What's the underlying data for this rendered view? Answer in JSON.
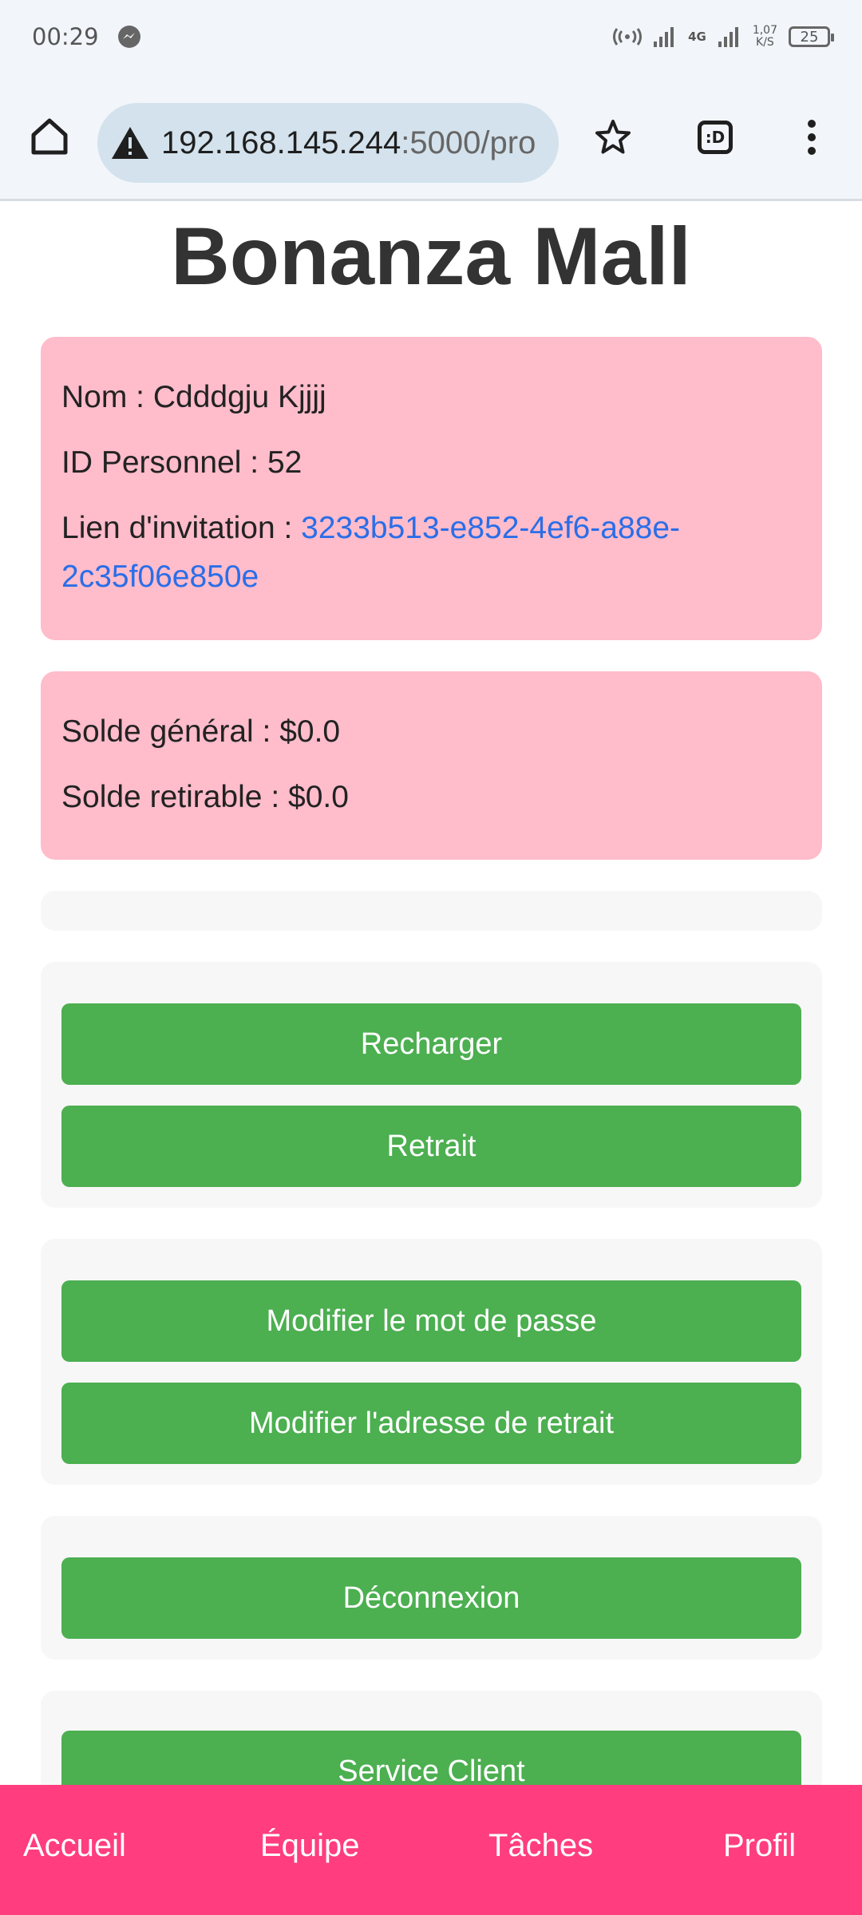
{
  "status_bar": {
    "time": "00:29",
    "network_label": "4G",
    "net_rate_value": "1,07",
    "net_rate_unit": "K/S",
    "battery": "25"
  },
  "browser": {
    "url_host": "192.168.145.244",
    "url_rest": ":5000/pro",
    "tabs_label": ":D"
  },
  "page": {
    "title": "Bonanza Mall"
  },
  "profile_card": {
    "name_label": "Nom : ",
    "name_value": "Cdddgju Kjjjj",
    "id_label": "ID Personnel : ",
    "id_value": "52",
    "invite_label": "Lien d'invitation : ",
    "invite_link_line1": "3233b513-e852-4ef6-a88e-",
    "invite_link_line2": "2c35f06e850e"
  },
  "balance_card": {
    "general_label": "Solde général : ",
    "general_value": "$0.0",
    "withdrawable_label": "Solde retirable : ",
    "withdrawable_value": "$0.0"
  },
  "actions": {
    "recharge": "Recharger",
    "withdraw": "Retrait",
    "change_password": "Modifier le mot de passe",
    "change_withdraw_address": "Modifier l'adresse de retrait",
    "logout": "Déconnexion",
    "customer_service": "Service Client"
  },
  "bottom_nav": {
    "home": "Accueil",
    "team": "Équipe",
    "tasks": "Tâches",
    "profile": "Profil"
  },
  "colors": {
    "pink_card": "#ffbccb",
    "green_button": "#4caf50",
    "nav_bar": "#ff3d7f",
    "link": "#2a6ee8"
  }
}
